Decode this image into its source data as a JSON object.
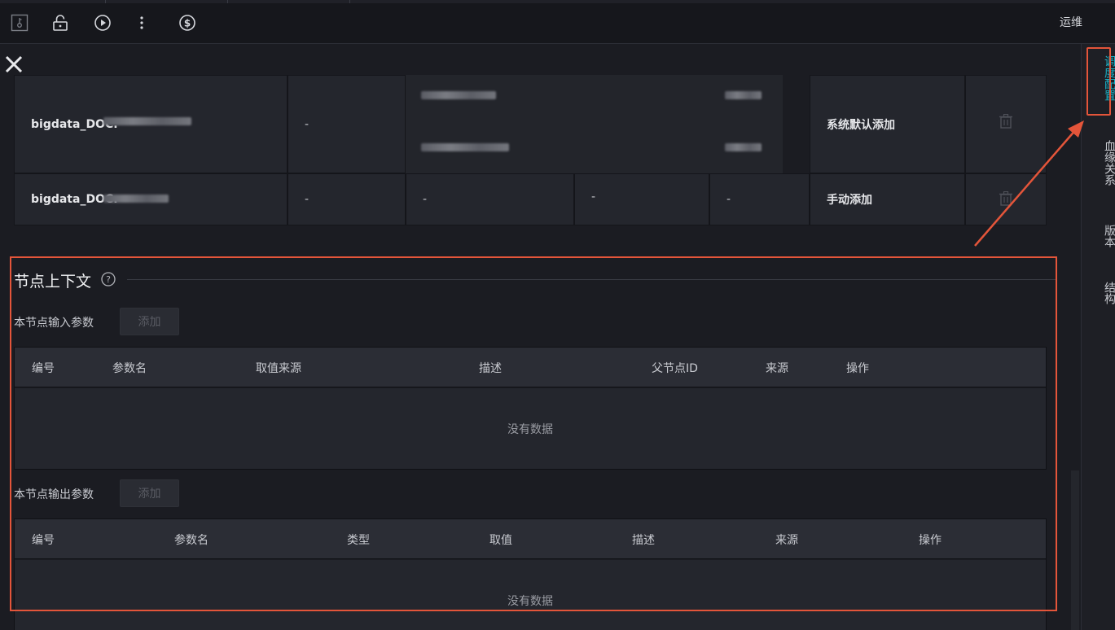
{
  "toolbar": {
    "icons": [
      "key-file-icon",
      "unlock-icon",
      "play-icon",
      "more-vertical-icon",
      "dollar-icon"
    ],
    "ops_label": "运维"
  },
  "right_rail": {
    "items": [
      {
        "label": "调度配置",
        "active": true
      },
      {
        "label": "血缘关系",
        "active": false
      },
      {
        "label": "版本",
        "active": false
      },
      {
        "label": "结构",
        "active": false
      }
    ]
  },
  "upper_table": {
    "rows": [
      {
        "name": "bigdata_DOC.",
        "col2": "-",
        "source": "系统默认添加"
      },
      {
        "name": "bigdata_DOC.",
        "col2": "-",
        "col3": "-",
        "col4": "-",
        "col5": "-",
        "source": "手动添加"
      }
    ]
  },
  "context": {
    "title": "节点上下文",
    "input": {
      "label": "本节点输入参数",
      "add_label": "添加",
      "columns": [
        "编号",
        "参数名",
        "取值来源",
        "描述",
        "父节点ID",
        "来源",
        "操作"
      ],
      "empty": "没有数据"
    },
    "output": {
      "label": "本节点输出参数",
      "add_label": "添加",
      "columns": [
        "编号",
        "参数名",
        "类型",
        "取值",
        "描述",
        "来源",
        "操作"
      ],
      "empty": "没有数据"
    }
  },
  "colors": {
    "accent": "#1ab3c7",
    "highlight": "#e4553a"
  }
}
